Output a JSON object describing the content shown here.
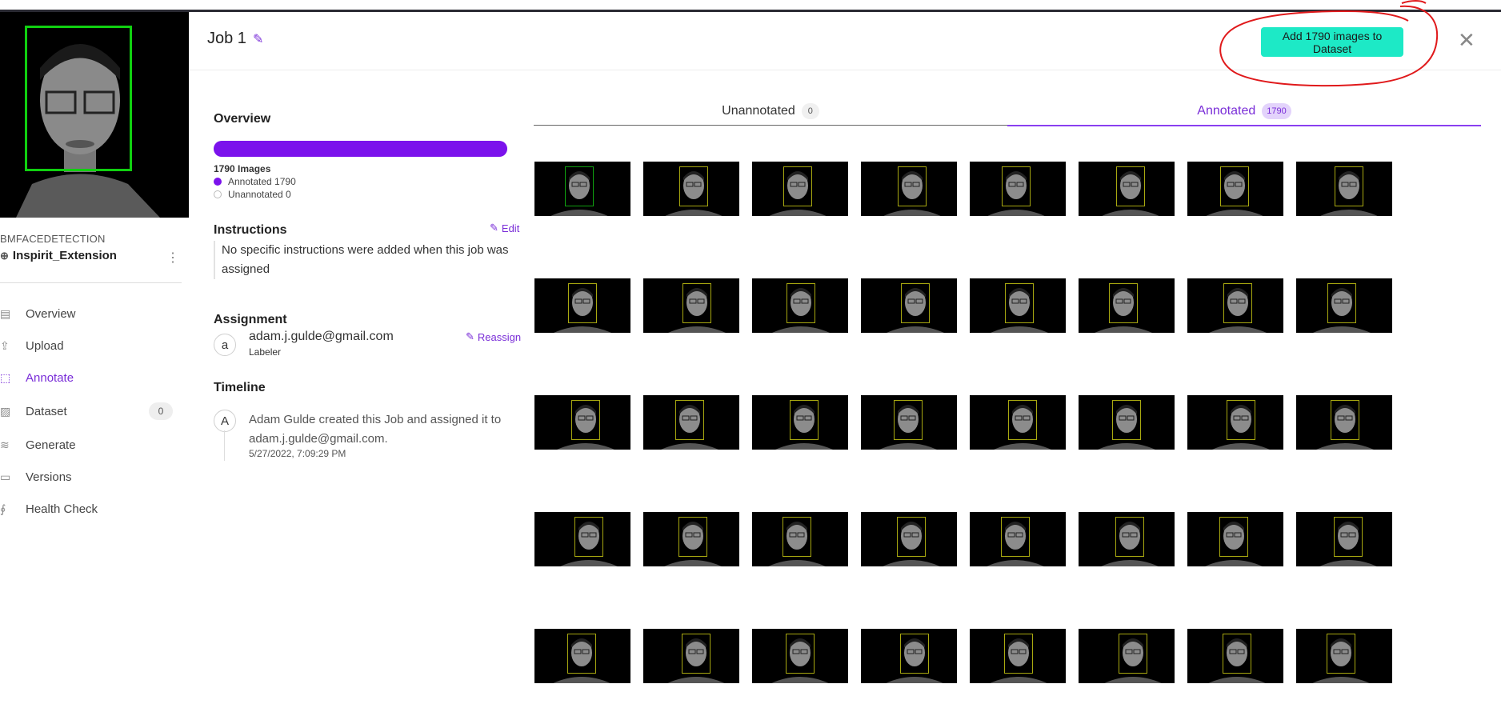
{
  "sidebar": {
    "project_type": "BMFACEDETECTION",
    "project_name": "Inspirit_Extension",
    "nav": [
      {
        "label": "Overview",
        "icon": "overview-icon",
        "glyph": "▤",
        "active": false
      },
      {
        "label": "Upload",
        "icon": "upload-icon",
        "glyph": "⇪",
        "active": false
      },
      {
        "label": "Annotate",
        "icon": "annotate-icon",
        "glyph": "⬚",
        "active": true
      },
      {
        "label": "Dataset",
        "icon": "dataset-icon",
        "glyph": "▨",
        "active": false,
        "badge": "0"
      },
      {
        "label": "Generate",
        "icon": "generate-icon",
        "glyph": "≋",
        "active": false
      },
      {
        "label": "Versions",
        "icon": "versions-icon",
        "glyph": "▭",
        "active": false
      },
      {
        "label": "Health Check",
        "icon": "stethoscope-icon",
        "glyph": "∮",
        "active": false
      }
    ]
  },
  "header": {
    "job_title": "Job 1",
    "add_button_label": "Add 1790 images to Dataset",
    "close_glyph": "✕"
  },
  "overview": {
    "heading": "Overview",
    "progress_fraction": 1.0,
    "images_label": "1790 Images",
    "annotated_label": "Annotated 1790",
    "unannotated_label": "Unannotated 0"
  },
  "instructions": {
    "heading": "Instructions",
    "edit_label": "Edit",
    "text": "No specific instructions were added when this job was assigned"
  },
  "assignment": {
    "heading": "Assignment",
    "reassign_label": "Reassign",
    "avatar_letter": "a",
    "email": "adam.j.gulde@gmail.com",
    "role": "Labeler"
  },
  "timeline": {
    "heading": "Timeline",
    "avatar_letter": "A",
    "event_text": "Adam Gulde created this Job and assigned it to adam.j.gulde@gmail.com.",
    "event_time": "5/27/2022, 7:09:29 PM"
  },
  "tabs": [
    {
      "label": "Unannotated",
      "count": "0"
    },
    {
      "label": "Annotated",
      "count": "1790"
    }
  ],
  "colors": {
    "accent": "#7a2ed8",
    "progress": "#7b12ec",
    "button": "#1de9c6",
    "bbox_main": "#10d010",
    "bbox_thumb": "#a8a810",
    "scribble": "#e0191b"
  },
  "grid": {
    "rows": 5,
    "columns": 8
  }
}
